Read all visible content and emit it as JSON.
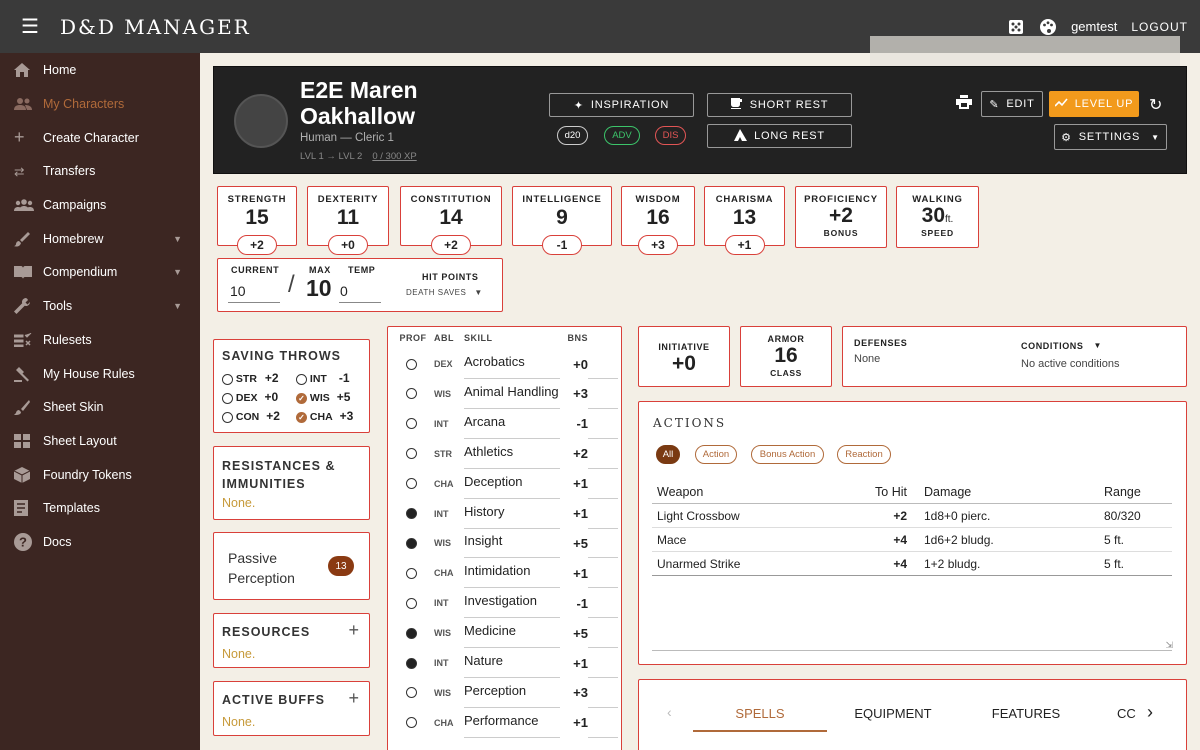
{
  "topbar": {
    "brand": "D&D MANAGER",
    "user": "gemtest",
    "logout": "LOGOUT"
  },
  "sidebar": {
    "items": [
      {
        "label": "Home",
        "icon": "home-icon"
      },
      {
        "label": "My Characters",
        "icon": "people-icon",
        "active": true
      },
      {
        "label": "Create Character",
        "icon": "plus-icon"
      },
      {
        "label": "Transfers",
        "icon": "swap-icon"
      },
      {
        "label": "Campaigns",
        "icon": "group-icon"
      },
      {
        "label": "Homebrew",
        "icon": "brush-icon",
        "expandable": true
      },
      {
        "label": "Compendium",
        "icon": "book-icon",
        "expandable": true
      },
      {
        "label": "Tools",
        "icon": "wrench-icon",
        "expandable": true
      },
      {
        "label": "Rulesets",
        "icon": "rules-icon"
      },
      {
        "label": "My House Rules",
        "icon": "gavel-icon"
      },
      {
        "label": "Sheet Skin",
        "icon": "paint-icon"
      },
      {
        "label": "Sheet Layout",
        "icon": "layout-icon"
      },
      {
        "label": "Foundry Tokens",
        "icon": "token-icon"
      },
      {
        "label": "Templates",
        "icon": "template-icon"
      },
      {
        "label": "Docs",
        "icon": "help-icon"
      }
    ]
  },
  "character": {
    "name_line1": "E2E Maren",
    "name_line2": "Oakhallow",
    "race_class": "Human — Cleric 1",
    "level": "LVL 1 → LVL 2",
    "xp": "0 / 300 XP"
  },
  "hero_buttons": {
    "inspiration": "INSPIRATION",
    "short_rest": "SHORT REST",
    "long_rest": "LONG REST",
    "d20": "d20",
    "adv": "ADV",
    "dis": "DIS",
    "edit": "EDIT",
    "level_up": "LEVEL UP",
    "settings": "SETTINGS"
  },
  "abilities": [
    {
      "label": "STRENGTH",
      "score": "15",
      "mod": "+2"
    },
    {
      "label": "DEXTERITY",
      "score": "11",
      "mod": "+0"
    },
    {
      "label": "CONSTITUTION",
      "score": "14",
      "mod": "+2"
    },
    {
      "label": "INTELLIGENCE",
      "score": "9",
      "mod": "-1"
    },
    {
      "label": "WISDOM",
      "score": "16",
      "mod": "+3"
    },
    {
      "label": "CHARISMA",
      "score": "13",
      "mod": "+1"
    }
  ],
  "proficiency": {
    "label": "PROFICIENCY",
    "value": "+2",
    "sub": "BONUS"
  },
  "walking": {
    "label": "WALKING",
    "value": "30",
    "unit": "ft.",
    "sub": "SPEED"
  },
  "hp": {
    "current_label": "CURRENT",
    "current": "10",
    "slash": "/",
    "max_label": "MAX",
    "max": "10",
    "temp_label": "TEMP",
    "temp": "0",
    "title": "HIT POINTS",
    "death_saves": "DEATH SAVES"
  },
  "saving_throws": {
    "title": "SAVING THROWS",
    "items": [
      {
        "abl": "STR",
        "val": "+2",
        "prof": false
      },
      {
        "abl": "INT",
        "val": "-1",
        "prof": false
      },
      {
        "abl": "DEX",
        "val": "+0",
        "prof": false
      },
      {
        "abl": "WIS",
        "val": "+5",
        "prof": true
      },
      {
        "abl": "CON",
        "val": "+2",
        "prof": false
      },
      {
        "abl": "CHA",
        "val": "+3",
        "prof": true
      }
    ]
  },
  "resistances": {
    "title1": "RESISTANCES &",
    "title2": "IMMUNITIES",
    "value": "None."
  },
  "passive": {
    "label1": "Passive",
    "label2": "Perception",
    "value": "13"
  },
  "resources": {
    "title": "RESOURCES",
    "value": "None."
  },
  "buffs": {
    "title": "ACTIVE BUFFS",
    "value": "None."
  },
  "skills": {
    "headers": {
      "prof": "PROF",
      "abl": "ABL",
      "skill": "SKILL",
      "bns": "BNS"
    },
    "items": [
      {
        "abl": "DEX",
        "name": "Acrobatics",
        "bns": "+0",
        "prof": false
      },
      {
        "abl": "WIS",
        "name": "Animal Handling",
        "bns": "+3",
        "prof": false
      },
      {
        "abl": "INT",
        "name": "Arcana",
        "bns": "-1",
        "prof": false
      },
      {
        "abl": "STR",
        "name": "Athletics",
        "bns": "+2",
        "prof": false
      },
      {
        "abl": "CHA",
        "name": "Deception",
        "bns": "+1",
        "prof": false
      },
      {
        "abl": "INT",
        "name": "History",
        "bns": "+1",
        "prof": true
      },
      {
        "abl": "WIS",
        "name": "Insight",
        "bns": "+5",
        "prof": true
      },
      {
        "abl": "CHA",
        "name": "Intimidation",
        "bns": "+1",
        "prof": false
      },
      {
        "abl": "INT",
        "name": "Investigation",
        "bns": "-1",
        "prof": false
      },
      {
        "abl": "WIS",
        "name": "Medicine",
        "bns": "+5",
        "prof": true
      },
      {
        "abl": "INT",
        "name": "Nature",
        "bns": "+1",
        "prof": true
      },
      {
        "abl": "WIS",
        "name": "Perception",
        "bns": "+3",
        "prof": false
      },
      {
        "abl": "CHA",
        "name": "Performance",
        "bns": "+1",
        "prof": false
      }
    ]
  },
  "initiative": {
    "label": "INITIATIVE",
    "value": "+0"
  },
  "armor": {
    "label": "ARMOR",
    "value": "16",
    "sub": "CLASS"
  },
  "defenses": {
    "label": "DEFENSES",
    "value": "None",
    "cond_label": "CONDITIONS",
    "cond_value": "No active conditions"
  },
  "actions": {
    "title": "ACTIONS",
    "tabs": [
      "All",
      "Action",
      "Bonus Action",
      "Reaction"
    ],
    "headers": {
      "weapon": "Weapon",
      "tohit": "To Hit",
      "damage": "Damage",
      "range": "Range"
    },
    "rows": [
      {
        "weapon": "Light Crossbow",
        "tohit": "+2",
        "damage": "1d8+0 pierc.",
        "range": "80/320"
      },
      {
        "weapon": "Mace",
        "tohit": "+4",
        "damage": "1d6+2 bludg.",
        "range": "5 ft."
      },
      {
        "weapon": "Unarmed Strike",
        "tohit": "+4",
        "damage": "1+2 bludg.",
        "range": "5 ft."
      }
    ]
  },
  "bottom_tabs": [
    "SPELLS",
    "EQUIPMENT",
    "FEATURES",
    "CC"
  ],
  "colors": {
    "accent": "#d9403a",
    "brand": "#b06a3a",
    "levelup": "#f29a1c",
    "sidebar": "#3c2622",
    "topbar": "#3a3a3a"
  }
}
